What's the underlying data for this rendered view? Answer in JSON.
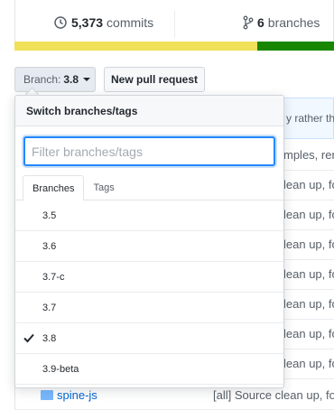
{
  "repo_stats": {
    "commits_count": "5,373",
    "commits_label": "commits",
    "branches_count": "6",
    "branches_label": "branches"
  },
  "language_bar": [
    {
      "color": "#f1e05a",
      "fraction": 0.76
    },
    {
      "color": "#178600",
      "fraction": 0.24
    }
  ],
  "toolbar": {
    "branch_prefix": "Branch:",
    "branch_value": "3.8",
    "new_pull_request": "New pull request"
  },
  "file_list_background": {
    "header_fragment": "y rather tha",
    "row_fragments": [
      "mples, rem",
      "lean up, fo",
      "lean up, fo",
      "lean up, fo",
      "lean up, fo",
      "lean up, fo",
      "lean up, fo",
      "lean up, fo"
    ],
    "last_row": {
      "name": "spine-js",
      "message": "[all] Source clean up, fo"
    }
  },
  "branch_menu": {
    "title": "Switch branches/tags",
    "filter_placeholder": "Filter branches/tags",
    "filter_value": "",
    "tabs": [
      {
        "label": "Branches",
        "active": true
      },
      {
        "label": "Tags",
        "active": false
      }
    ],
    "items": [
      {
        "label": "3.5",
        "selected": false
      },
      {
        "label": "3.6",
        "selected": false
      },
      {
        "label": "3.7-c",
        "selected": false
      },
      {
        "label": "3.7",
        "selected": false
      },
      {
        "label": "3.8",
        "selected": true
      },
      {
        "label": "3.9-beta",
        "selected": false
      }
    ]
  },
  "icons": {
    "commits": "history-icon",
    "branches": "git-branch-icon",
    "selected": "check-icon",
    "folder": "folder-icon"
  },
  "colors": {
    "accent": "#2188ff",
    "link": "#0366d6"
  }
}
